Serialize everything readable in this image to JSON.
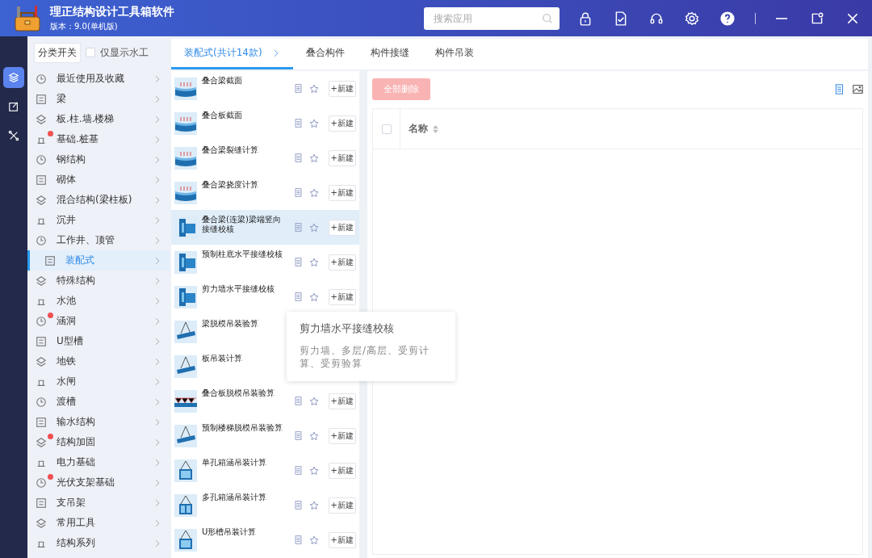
{
  "app": {
    "title": "理正结构设计工具箱软件",
    "version": "版本：9.0(单机版)"
  },
  "search": {
    "placeholder": "搜索应用"
  },
  "rail": [
    {
      "selected": true
    },
    {
      "selected": false
    },
    {
      "selected": false
    }
  ],
  "category_panel": {
    "toggle_button": "分类开关",
    "water_only": {
      "label": "仅显示水工",
      "checked": false
    },
    "items": [
      {
        "label": "最近使用及收藏",
        "selected": false,
        "badge": false
      },
      {
        "label": "梁",
        "selected": false,
        "badge": false
      },
      {
        "label": "板.柱.墙.楼梯",
        "selected": false,
        "badge": false
      },
      {
        "label": "基础.桩基",
        "selected": false,
        "badge": true
      },
      {
        "label": "钢结构",
        "selected": false,
        "badge": false
      },
      {
        "label": "砌体",
        "selected": false,
        "badge": false
      },
      {
        "label": "混合结构(梁柱板)",
        "selected": false,
        "badge": false
      },
      {
        "label": "沉井",
        "selected": false,
        "badge": false
      },
      {
        "label": "工作井、顶管",
        "selected": false,
        "badge": false
      },
      {
        "label": "装配式",
        "selected": true,
        "badge": false
      },
      {
        "label": "特殊结构",
        "selected": false,
        "badge": false
      },
      {
        "label": "水池",
        "selected": false,
        "badge": false
      },
      {
        "label": "涵洞",
        "selected": false,
        "badge": true
      },
      {
        "label": "U型槽",
        "selected": false,
        "badge": false
      },
      {
        "label": "地铁",
        "selected": false,
        "badge": false
      },
      {
        "label": "水闸",
        "selected": false,
        "badge": false
      },
      {
        "label": "渡槽",
        "selected": false,
        "badge": false
      },
      {
        "label": "输水结构",
        "selected": false,
        "badge": false
      },
      {
        "label": "结构加固",
        "selected": false,
        "badge": true
      },
      {
        "label": "电力基础",
        "selected": false,
        "badge": false
      },
      {
        "label": "光伏支架基础",
        "selected": false,
        "badge": true
      },
      {
        "label": "支吊架",
        "selected": false,
        "badge": false
      },
      {
        "label": "常用工具",
        "selected": false,
        "badge": false
      },
      {
        "label": "结构系列",
        "selected": false,
        "badge": false
      }
    ]
  },
  "tabs": [
    {
      "label": "装配式(共计14款)",
      "selected": true
    },
    {
      "label": "叠合构件",
      "selected": false
    },
    {
      "label": "构件接缝",
      "selected": false
    },
    {
      "label": "构件吊装",
      "selected": false
    }
  ],
  "tools": {
    "items": [
      {
        "name": "叠合梁截面",
        "kind": "section",
        "selected": false,
        "new_label": "+新建"
      },
      {
        "name": "叠合板截面",
        "kind": "section",
        "selected": false,
        "new_label": "+新建"
      },
      {
        "name": "叠合梁裂缝计算",
        "kind": "section",
        "selected": false,
        "new_label": "+新建"
      },
      {
        "name": "叠合梁挠度计算",
        "kind": "section",
        "selected": false,
        "new_label": "+新建"
      },
      {
        "name": "叠合梁(连梁)梁端竖向接缝校核",
        "kind": "joint",
        "selected": true,
        "new_label": "+新建"
      },
      {
        "name": "预制柱底水平接缝校核",
        "kind": "joint",
        "selected": false,
        "new_label": "+新建"
      },
      {
        "name": "剪力墙水平接缝校核",
        "kind": "joint",
        "selected": false,
        "new_label": "+新建"
      },
      {
        "name": "梁脱模吊装验算",
        "kind": "lift",
        "selected": false
      },
      {
        "name": "板吊装计算",
        "kind": "lift",
        "selected": false
      },
      {
        "name": "叠合板脱模吊装验算",
        "kind": "truss",
        "selected": false,
        "new_label": "+新建"
      },
      {
        "name": "预制楼梯脱模吊装验算",
        "kind": "lift",
        "selected": false,
        "new_label": "+新建"
      },
      {
        "name": "单孔箱涵吊装计算",
        "kind": "box",
        "selected": false,
        "new_label": "+新建"
      },
      {
        "name": "多孔箱涵吊装计算",
        "kind": "box2",
        "selected": false,
        "new_label": "+新建"
      },
      {
        "name": "U形槽吊装计算",
        "kind": "box",
        "selected": false,
        "new_label": "+新建"
      }
    ]
  },
  "tooltip": {
    "title": "剪力墙水平接缝校核",
    "text": "剪力墙、多层/高层、受剪计算、受剪验算"
  },
  "records": {
    "delete_all": {
      "label": "全部删除",
      "disabled": true
    },
    "select_all": {
      "checked": false
    },
    "columns": [
      "名称"
    ]
  }
}
